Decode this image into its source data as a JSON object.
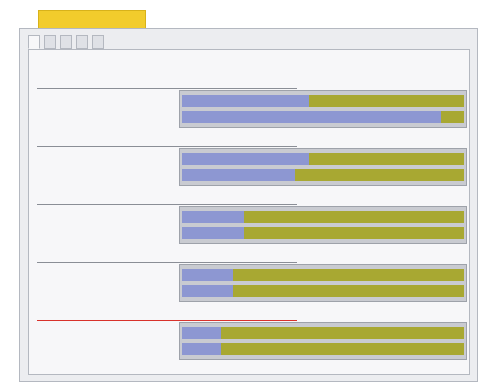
{
  "window": {
    "title": ""
  },
  "tabs": [
    {
      "label": "",
      "active": true
    },
    {
      "label": "",
      "active": false
    },
    {
      "label": "",
      "active": false
    },
    {
      "label": "",
      "active": false
    },
    {
      "label": "",
      "active": false
    }
  ],
  "panel": {
    "heading": ""
  },
  "groups": [
    {
      "title": "",
      "color": "#222222",
      "rows": [
        {
          "label": "",
          "value": "",
          "fill": 0.45
        },
        {
          "label": "",
          "value": "",
          "fill": 0.92
        }
      ]
    },
    {
      "title": "",
      "color": "#222222",
      "rows": [
        {
          "label": "",
          "value": "",
          "fill": 0.45
        },
        {
          "label": "",
          "value": "",
          "fill": 0.4
        }
      ]
    },
    {
      "title": "",
      "color": "#222222",
      "rows": [
        {
          "label": "",
          "value": "",
          "fill": 0.22
        },
        {
          "label": "",
          "value": "",
          "fill": 0.22
        }
      ]
    },
    {
      "title": "",
      "color": "#222222",
      "rows": [
        {
          "label": "",
          "value": "",
          "fill": 0.18
        },
        {
          "label": "",
          "value": "",
          "fill": 0.18
        }
      ]
    },
    {
      "title": "",
      "color": "#d8322c",
      "rows": [
        {
          "label": "",
          "value": "",
          "fill": 0.14
        },
        {
          "label": "",
          "value": "",
          "fill": 0.14
        }
      ]
    }
  ],
  "colors": {
    "accent": "#f2cc2c",
    "bar_fill": "#8d97d2",
    "bar_remaining": "#a8a832",
    "highlight": "#d8322c"
  }
}
